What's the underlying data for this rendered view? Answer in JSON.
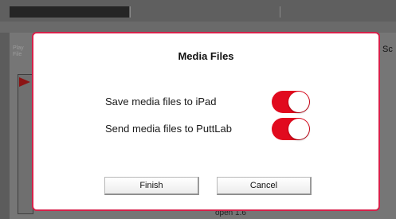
{
  "background": {
    "side_text_line1": "Play",
    "side_text_line2": "File",
    "right_text": "Sc",
    "bottom_text": "open 1.6"
  },
  "dialog": {
    "title": "Media Files",
    "settings": [
      {
        "label": "Save media files to iPad",
        "enabled": true
      },
      {
        "label": "Send media files to PuttLab",
        "enabled": true
      }
    ],
    "finish_label": "Finish",
    "cancel_label": "Cancel"
  },
  "colors": {
    "accent": "#e10a1e",
    "dialog_border": "#d6214a"
  }
}
